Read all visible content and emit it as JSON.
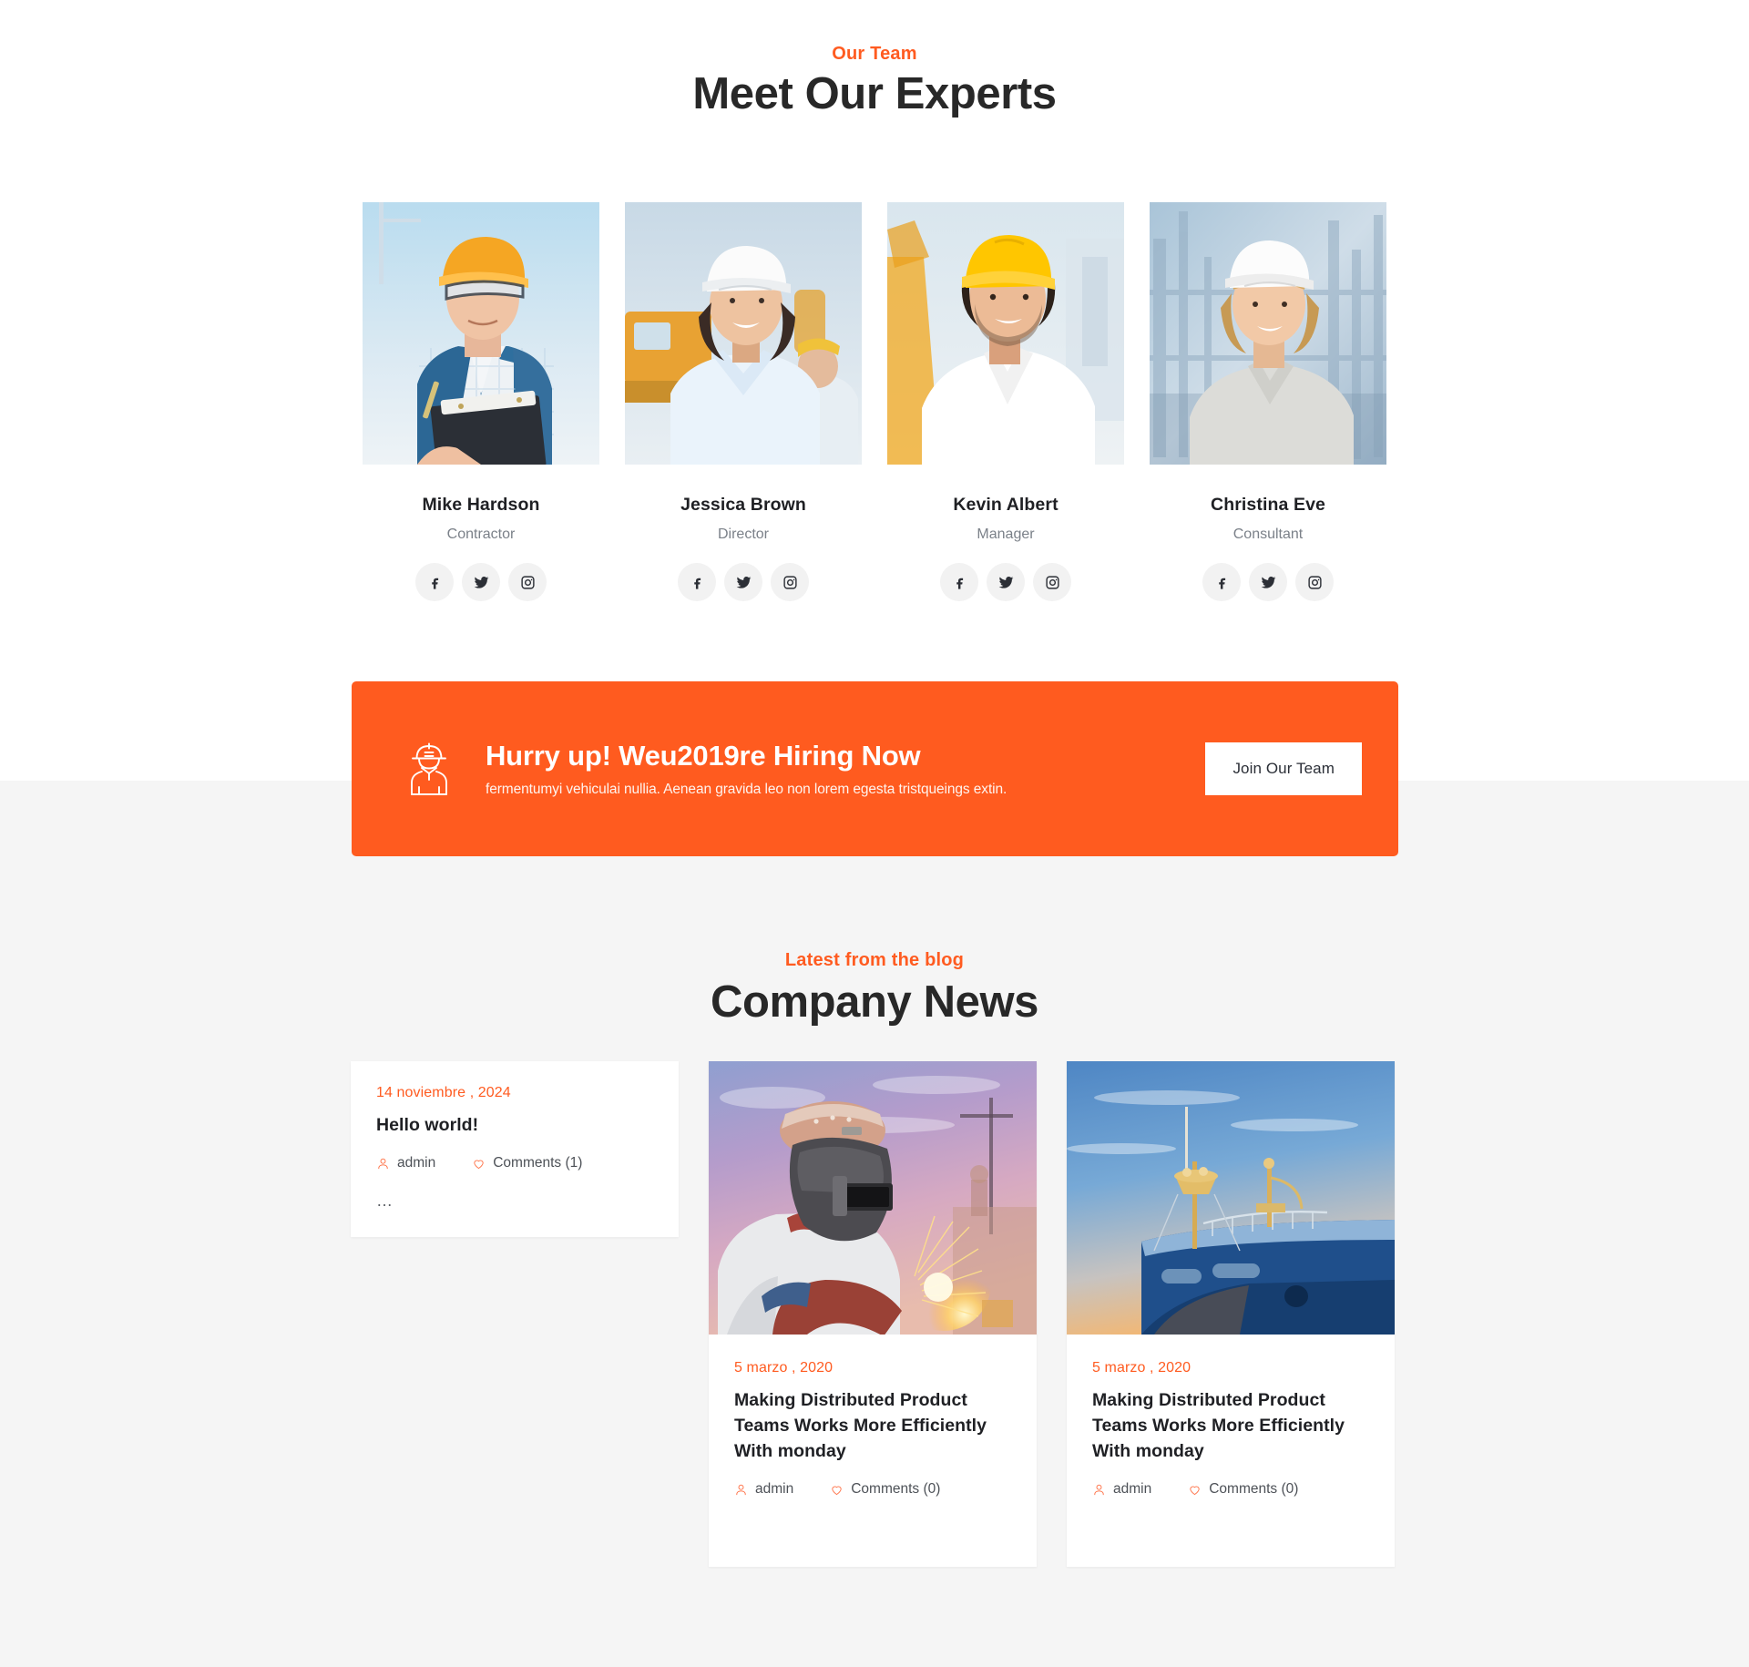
{
  "team": {
    "eyebrow": "Our Team",
    "title": "Meet Our Experts",
    "members": [
      {
        "name": "Mike Hardson",
        "role": "Contractor",
        "photo_alt": "construction worker in orange hard hat with clipboard"
      },
      {
        "name": "Jessica Brown",
        "role": "Director",
        "photo_alt": "smiling woman in white hard hat at construction site"
      },
      {
        "name": "Kevin Albert",
        "role": "Manager",
        "photo_alt": "man in yellow hard hat and white shirt"
      },
      {
        "name": "Christina Eve",
        "role": "Consultant",
        "photo_alt": "blonde woman in white hard hat"
      }
    ],
    "social": [
      "facebook-icon",
      "twitter-icon",
      "instagram-icon"
    ]
  },
  "hiring_banner": {
    "icon": "construction-worker-icon",
    "title": "Hurry up! Weu2019re Hiring Now",
    "subtitle": "fermentumyi vehiculai nullia. Aenean gravida leo non lorem egesta tristqueings extin.",
    "button_label": "Join Our Team",
    "background_color": "#ff5b1f",
    "button_background": "#ffffff"
  },
  "news": {
    "eyebrow": "Latest from the blog",
    "title": "Company News",
    "posts": [
      {
        "date": "14 noviembre , 2024",
        "headline": "Hello world!",
        "author": "admin",
        "comments": "Comments (1)",
        "excerpt": "…",
        "has_image": false
      },
      {
        "date": "5 marzo , 2020",
        "headline": "Making Distributed Product Teams Works More Efficiently With monday",
        "author": "admin",
        "comments": "Comments (0)",
        "excerpt": "",
        "has_image": true,
        "photo_alt": "welder with mask and sparks at sunset"
      },
      {
        "date": "5 marzo , 2020",
        "headline": "Making Distributed Product Teams Works More Efficiently With monday",
        "author": "admin",
        "comments": "Comments (0)",
        "excerpt": "",
        "has_image": true,
        "photo_alt": "blue cargo ship bow at sunset"
      }
    ],
    "icons": {
      "author": "user-icon",
      "comments": "heart-icon"
    }
  },
  "colors": {
    "accent": "#ff5b20",
    "banner": "#ff5b1f",
    "heading": "#282828",
    "page_bg_top": "#ffffff",
    "page_bg_bottom": "#f5f5f5",
    "muted_text": "#7b8189"
  }
}
